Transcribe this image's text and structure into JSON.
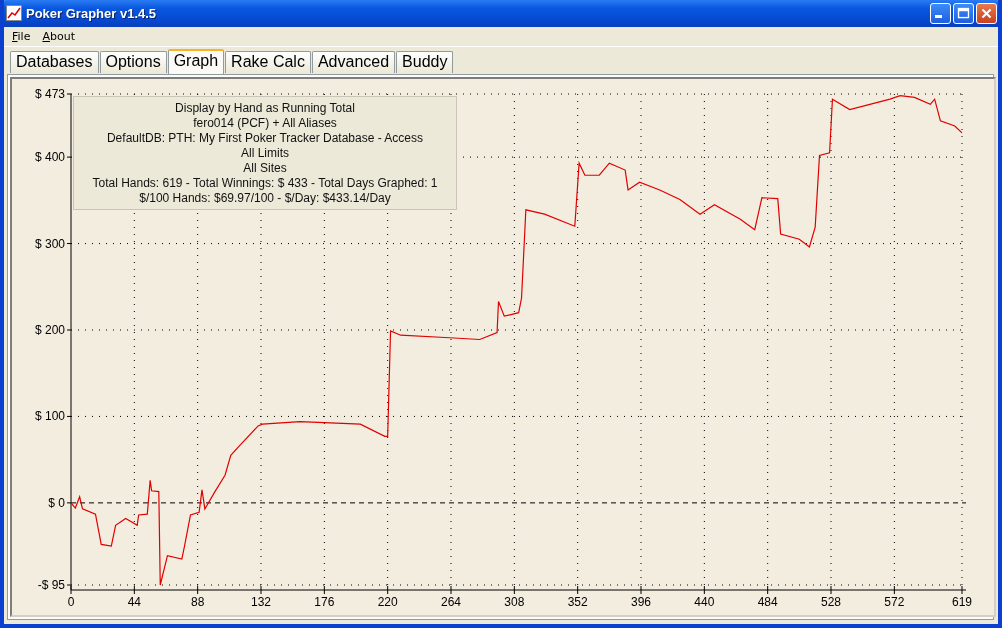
{
  "window": {
    "title": "Poker Grapher v1.4.5"
  },
  "menu": [
    {
      "label": "File"
    },
    {
      "label": "About"
    }
  ],
  "tabs": [
    {
      "label": "Databases",
      "selected": false
    },
    {
      "label": "Options",
      "selected": false
    },
    {
      "label": "Graph",
      "selected": true
    },
    {
      "label": "Rake Calc",
      "selected": false
    },
    {
      "label": "Advanced",
      "selected": false
    },
    {
      "label": "Buddy",
      "selected": false
    }
  ],
  "info_box": {
    "lines": [
      "Display by Hand as Running Total",
      "fero014 (PCF) + All Aliases",
      "DefaultDB: PTH: My First Poker Tracker Database - Access",
      "All Limits",
      "All Sites",
      "Total Hands: 619 - Total Winnings: $ 433 - Total Days Graphed: 1",
      "$/100 Hands: $69.97/100 - $/Day: $433.14/Day"
    ]
  },
  "chart_data": {
    "type": "line",
    "xlim": [
      0,
      619
    ],
    "ylim": [
      -95,
      473
    ],
    "xticks": [
      0,
      44,
      88,
      132,
      176,
      220,
      264,
      308,
      352,
      396,
      440,
      484,
      528,
      572,
      619
    ],
    "yticks": [
      {
        "value": -95,
        "label": "-$ 95"
      },
      {
        "value": 0,
        "label": "$ 0"
      },
      {
        "value": 100,
        "label": "$ 100"
      },
      {
        "value": 200,
        "label": "$ 200"
      },
      {
        "value": 300,
        "label": "$ 300"
      },
      {
        "value": 400,
        "label": "$ 400"
      },
      {
        "value": 473,
        "label": "$ 473"
      }
    ],
    "x": [
      0,
      3,
      6,
      8,
      17,
      21,
      28,
      31,
      38,
      46,
      47,
      53,
      55,
      56,
      61,
      62,
      67,
      77,
      79,
      83,
      89,
      91,
      93,
      100,
      107,
      111,
      117,
      130,
      133,
      159,
      201,
      218,
      220,
      222,
      229,
      263,
      284,
      296,
      297,
      301,
      311,
      313,
      316,
      329,
      350,
      353,
      357,
      367,
      374,
      385,
      387,
      395,
      409,
      423,
      437,
      447,
      465,
      475,
      480,
      491,
      493,
      506,
      513,
      517,
      520,
      527,
      529,
      541,
      555,
      569,
      576,
      586,
      597,
      600,
      604,
      614,
      619
    ],
    "grid": true,
    "series": [
      {
        "color": "#e00000",
        "values": [
          0,
          -6,
          7,
          -7,
          -13,
          -48,
          -50,
          -26,
          -18,
          -26,
          -14,
          -13,
          26,
          14,
          13,
          -95,
          -61,
          -65,
          -49,
          -14,
          -11,
          15,
          -7,
          13,
          32,
          55,
          66,
          89,
          91,
          94,
          91,
          77,
          77,
          199,
          194,
          191,
          189,
          197,
          233,
          216,
          220,
          237,
          339,
          334,
          320,
          393,
          379,
          379,
          393,
          385,
          362,
          371,
          362,
          351,
          334,
          345,
          328,
          316,
          353,
          352,
          311,
          305,
          296,
          319,
          402,
          405,
          467,
          455,
          461,
          467,
          471,
          469,
          461,
          467,
          442,
          436,
          428
        ]
      }
    ]
  }
}
